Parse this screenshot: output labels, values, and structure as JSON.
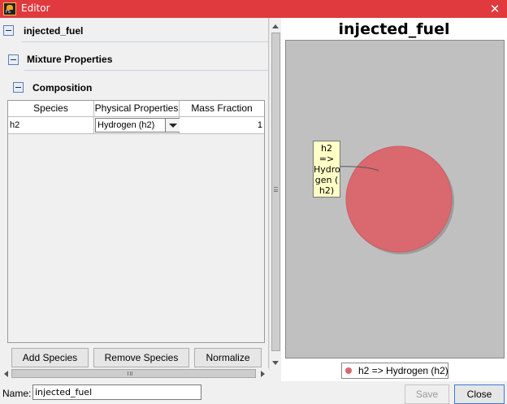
{
  "window": {
    "title": "Editor",
    "close_glyph": "✕"
  },
  "object_header": {
    "label": "injected_fuel"
  },
  "mixture_section": {
    "label": "Mixture Properties"
  },
  "composition_section": {
    "label": "Composition"
  },
  "species_table": {
    "columns": [
      "Species",
      "Physical Properties",
      "Mass Fraction"
    ],
    "rows": [
      {
        "species": "h2",
        "physical_properties": "Hydrogen (h2)",
        "mass_fraction": "1"
      }
    ]
  },
  "table_buttons": {
    "add": "Add Species",
    "remove": "Remove Species",
    "normalize": "Normalize"
  },
  "preview": {
    "title": "injected_fuel",
    "tooltip_lines": [
      "h2",
      "=>",
      "Hydro",
      "gen (",
      "h2)"
    ],
    "legend_label": "h2 => Hydrogen (h2)"
  },
  "chart_data": {
    "type": "pie",
    "title": "injected_fuel",
    "categories": [
      "h2 => Hydrogen (h2)"
    ],
    "values": [
      1.0
    ],
    "colors": [
      "#d9696f"
    ],
    "legend_position": "bottom"
  },
  "footer": {
    "name_label": "Name:",
    "name_value": "injected_fuel",
    "save_label": "Save",
    "close_label": "Close"
  },
  "colors": {
    "titlebar": "#e03a3e",
    "pie_fill": "#d9696f",
    "plot_background": "#c0c0c0",
    "tooltip_background": "#ffffc6"
  }
}
